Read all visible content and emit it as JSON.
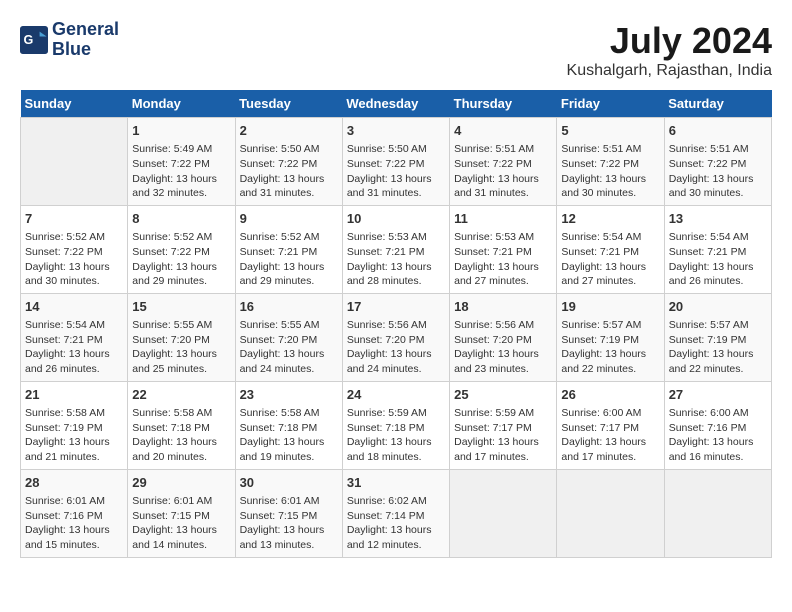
{
  "header": {
    "logo_line1": "General",
    "logo_line2": "Blue",
    "month_year": "July 2024",
    "location": "Kushalgarh, Rajasthan, India"
  },
  "days_of_week": [
    "Sunday",
    "Monday",
    "Tuesday",
    "Wednesday",
    "Thursday",
    "Friday",
    "Saturday"
  ],
  "weeks": [
    [
      {
        "day": "",
        "content": ""
      },
      {
        "day": "1",
        "content": "Sunrise: 5:49 AM\nSunset: 7:22 PM\nDaylight: 13 hours and 32 minutes."
      },
      {
        "day": "2",
        "content": "Sunrise: 5:50 AM\nSunset: 7:22 PM\nDaylight: 13 hours and 31 minutes."
      },
      {
        "day": "3",
        "content": "Sunrise: 5:50 AM\nSunset: 7:22 PM\nDaylight: 13 hours and 31 minutes."
      },
      {
        "day": "4",
        "content": "Sunrise: 5:51 AM\nSunset: 7:22 PM\nDaylight: 13 hours and 31 minutes."
      },
      {
        "day": "5",
        "content": "Sunrise: 5:51 AM\nSunset: 7:22 PM\nDaylight: 13 hours and 30 minutes."
      },
      {
        "day": "6",
        "content": "Sunrise: 5:51 AM\nSunset: 7:22 PM\nDaylight: 13 hours and 30 minutes."
      }
    ],
    [
      {
        "day": "7",
        "content": "Sunrise: 5:52 AM\nSunset: 7:22 PM\nDaylight: 13 hours and 30 minutes."
      },
      {
        "day": "8",
        "content": "Sunrise: 5:52 AM\nSunset: 7:22 PM\nDaylight: 13 hours and 29 minutes."
      },
      {
        "day": "9",
        "content": "Sunrise: 5:52 AM\nSunset: 7:21 PM\nDaylight: 13 hours and 29 minutes."
      },
      {
        "day": "10",
        "content": "Sunrise: 5:53 AM\nSunset: 7:21 PM\nDaylight: 13 hours and 28 minutes."
      },
      {
        "day": "11",
        "content": "Sunrise: 5:53 AM\nSunset: 7:21 PM\nDaylight: 13 hours and 27 minutes."
      },
      {
        "day": "12",
        "content": "Sunrise: 5:54 AM\nSunset: 7:21 PM\nDaylight: 13 hours and 27 minutes."
      },
      {
        "day": "13",
        "content": "Sunrise: 5:54 AM\nSunset: 7:21 PM\nDaylight: 13 hours and 26 minutes."
      }
    ],
    [
      {
        "day": "14",
        "content": "Sunrise: 5:54 AM\nSunset: 7:21 PM\nDaylight: 13 hours and 26 minutes."
      },
      {
        "day": "15",
        "content": "Sunrise: 5:55 AM\nSunset: 7:20 PM\nDaylight: 13 hours and 25 minutes."
      },
      {
        "day": "16",
        "content": "Sunrise: 5:55 AM\nSunset: 7:20 PM\nDaylight: 13 hours and 24 minutes."
      },
      {
        "day": "17",
        "content": "Sunrise: 5:56 AM\nSunset: 7:20 PM\nDaylight: 13 hours and 24 minutes."
      },
      {
        "day": "18",
        "content": "Sunrise: 5:56 AM\nSunset: 7:20 PM\nDaylight: 13 hours and 23 minutes."
      },
      {
        "day": "19",
        "content": "Sunrise: 5:57 AM\nSunset: 7:19 PM\nDaylight: 13 hours and 22 minutes."
      },
      {
        "day": "20",
        "content": "Sunrise: 5:57 AM\nSunset: 7:19 PM\nDaylight: 13 hours and 22 minutes."
      }
    ],
    [
      {
        "day": "21",
        "content": "Sunrise: 5:58 AM\nSunset: 7:19 PM\nDaylight: 13 hours and 21 minutes."
      },
      {
        "day": "22",
        "content": "Sunrise: 5:58 AM\nSunset: 7:18 PM\nDaylight: 13 hours and 20 minutes."
      },
      {
        "day": "23",
        "content": "Sunrise: 5:58 AM\nSunset: 7:18 PM\nDaylight: 13 hours and 19 minutes."
      },
      {
        "day": "24",
        "content": "Sunrise: 5:59 AM\nSunset: 7:18 PM\nDaylight: 13 hours and 18 minutes."
      },
      {
        "day": "25",
        "content": "Sunrise: 5:59 AM\nSunset: 7:17 PM\nDaylight: 13 hours and 17 minutes."
      },
      {
        "day": "26",
        "content": "Sunrise: 6:00 AM\nSunset: 7:17 PM\nDaylight: 13 hours and 17 minutes."
      },
      {
        "day": "27",
        "content": "Sunrise: 6:00 AM\nSunset: 7:16 PM\nDaylight: 13 hours and 16 minutes."
      }
    ],
    [
      {
        "day": "28",
        "content": "Sunrise: 6:01 AM\nSunset: 7:16 PM\nDaylight: 13 hours and 15 minutes."
      },
      {
        "day": "29",
        "content": "Sunrise: 6:01 AM\nSunset: 7:15 PM\nDaylight: 13 hours and 14 minutes."
      },
      {
        "day": "30",
        "content": "Sunrise: 6:01 AM\nSunset: 7:15 PM\nDaylight: 13 hours and 13 minutes."
      },
      {
        "day": "31",
        "content": "Sunrise: 6:02 AM\nSunset: 7:14 PM\nDaylight: 13 hours and 12 minutes."
      },
      {
        "day": "",
        "content": ""
      },
      {
        "day": "",
        "content": ""
      },
      {
        "day": "",
        "content": ""
      }
    ]
  ]
}
